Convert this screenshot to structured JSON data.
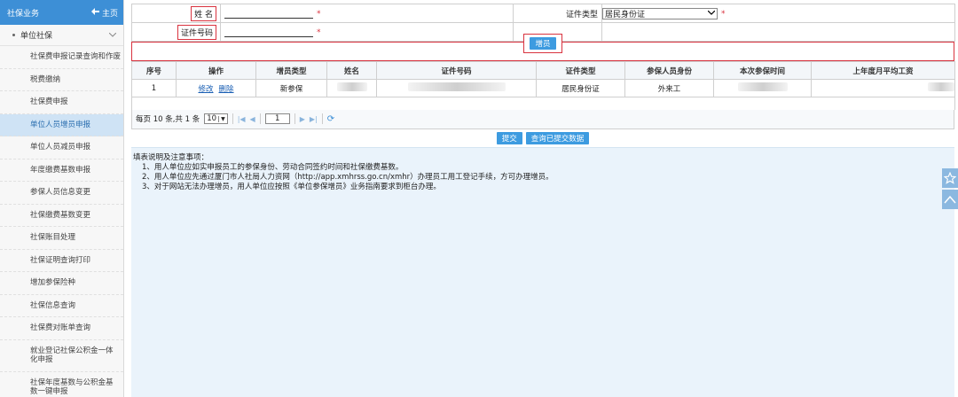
{
  "sidebar": {
    "header_title": "社保业务",
    "home_label": "主页",
    "group_label": "单位社保",
    "items": [
      {
        "label": "社保费申报记录查询和作废"
      },
      {
        "label": "税费缴纳"
      },
      {
        "label": "社保费申报"
      },
      {
        "label": "单位人员增员申报",
        "active": true
      },
      {
        "label": "单位人员减员申报"
      },
      {
        "label": "年度缴费基数申报"
      },
      {
        "label": "参保人员信息变更"
      },
      {
        "label": "社保缴费基数变更"
      },
      {
        "label": "社保账目处理"
      },
      {
        "label": "社保证明查询打印"
      },
      {
        "label": "增加参保险种"
      },
      {
        "label": "社保信息查询"
      },
      {
        "label": "社保费对账单查询"
      },
      {
        "label": "就业登记社保公积金一体化申报"
      },
      {
        "label": "社保年度基数与公积金基数一键申报"
      }
    ]
  },
  "form": {
    "name_label": "姓 名",
    "id_no_label": "证件号码",
    "id_type_label": "证件类型",
    "id_type_value": "居民身份证",
    "required_mark": "*",
    "add_button": "增员"
  },
  "grid": {
    "columns": [
      "序号",
      "操作",
      "增员类型",
      "姓名",
      "证件号码",
      "证件类型",
      "参保人员身份",
      "本次参保时间",
      "上年度月平均工资"
    ],
    "rows": [
      {
        "index": "1",
        "edit": "修改",
        "delete": "删除",
        "add_type": "新参保",
        "id_type": "居民身份证",
        "identity": "外来工"
      }
    ]
  },
  "pager": {
    "text": "每页 10 条,共 1 条",
    "page_size": "10",
    "page": "1"
  },
  "actions": {
    "submit": "提交",
    "query": "查询已提交数据"
  },
  "notes": {
    "title": "填表说明及注意事项：",
    "items": [
      "1、用人单位应如实申报员工的参保身份、劳动合同签约时间和社保缴费基数。",
      "2、用人单位应先通过厦门市人社局人力资网（http://app.xmhrss.go.cn/xmhr）办理员工用工登记手续，方可办理增员。",
      "3、对于网站无法办理增员，用人单位应按照《单位参保增员》业务指南要求到柜台办理。"
    ]
  },
  "colors": {
    "accent": "#3d8fd6",
    "highlight": "#d9333f",
    "active_bg": "#cfe3f5",
    "notes_bg": "#eaf3fb"
  }
}
